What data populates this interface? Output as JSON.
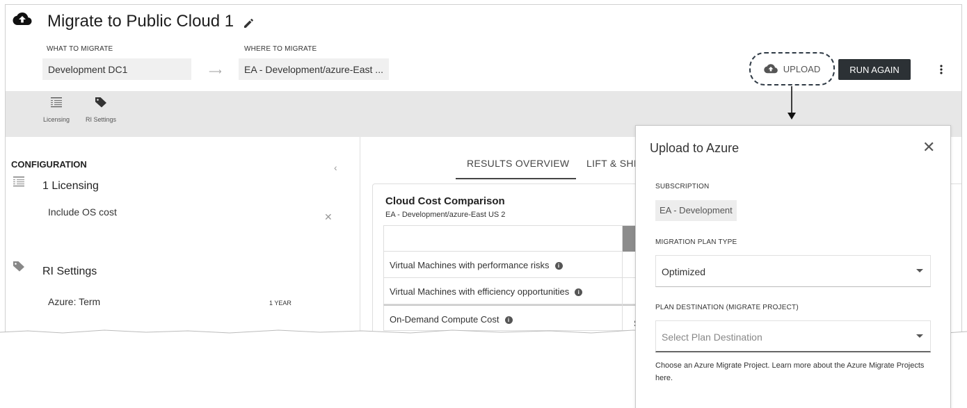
{
  "header": {
    "title": "Migrate to Public Cloud 1",
    "what_label": "WHAT TO MIGRATE",
    "what_value": "Development DC1",
    "where_label": "WHERE TO MIGRATE",
    "where_value": "EA - Development/azure-East ...",
    "upload_label": "UPLOAD",
    "run_again_label": "RUN AGAIN"
  },
  "toolbar": {
    "items": [
      {
        "label": "Licensing",
        "icon": "list-icon"
      },
      {
        "label": "RI Settings",
        "icon": "tag-icon"
      }
    ]
  },
  "config": {
    "title": "CONFIGURATION",
    "licensing_title": "1 Licensing",
    "licensing_item": "Include OS cost",
    "ri_title": "RI Settings",
    "ri_item": "Azure: Term",
    "ri_value": "1 YEAR"
  },
  "results": {
    "tabs": [
      "RESULTS OVERVIEW",
      "LIFT & SHI"
    ],
    "card_title": "Cloud Cost Comparison",
    "card_subtitle": "EA - Development/azure-East US 2",
    "rows": [
      "",
      "Virtual Machines with performance risks",
      "Virtual Machines with efficiency opportunities",
      "On-Demand Compute Cost"
    ],
    "cut_cell": "S"
  },
  "dialog": {
    "title": "Upload to Azure",
    "subscription_label": "SUBSCRIPTION",
    "subscription_value": "EA - Development",
    "plan_type_label": "MIGRATION PLAN TYPE",
    "plan_type_value": "Optimized",
    "destination_label": "PLAN DESTINATION (MIGRATE PROJECT)",
    "destination_placeholder": "Select Plan Destination",
    "help_text": "Choose an Azure Migrate Project. Learn more about the Azure Migrate Projects ",
    "help_link": "here",
    "help_end": "."
  },
  "colors": {
    "run_button": "#2c3135",
    "toolbar_bg": "#e7e7e7",
    "upload_dash": "#2f3a45"
  }
}
